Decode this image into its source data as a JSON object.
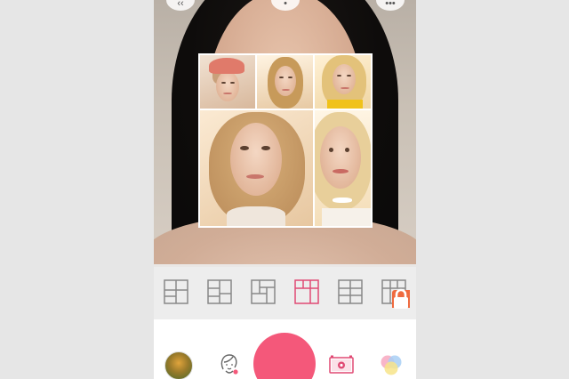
{
  "app": {
    "screen": "collage-camera"
  },
  "top_bar": {
    "buttons": [
      {
        "name": "back-icon"
      },
      {
        "name": "info-icon"
      },
      {
        "name": "more-icon"
      }
    ]
  },
  "collage": {
    "selected_layout_index": 3,
    "photos": [
      {
        "name": "collage-photo-1",
        "hair": "#d9b98a",
        "hat": "#e07a6a"
      },
      {
        "name": "collage-photo-2",
        "hair": "#c79a5a"
      },
      {
        "name": "collage-photo-3",
        "hair": "#e3c27a",
        "shirt": "#f0c21a"
      },
      {
        "name": "collage-photo-4",
        "hair": "#caa06a"
      },
      {
        "name": "collage-photo-5",
        "hair": "#e8cf9a"
      }
    ]
  },
  "layouts": [
    {
      "name": "layout-grid-1",
      "locked": false
    },
    {
      "name": "layout-grid-2",
      "locked": false
    },
    {
      "name": "layout-grid-3",
      "locked": false
    },
    {
      "name": "layout-grid-4",
      "locked": false,
      "selected": true
    },
    {
      "name": "layout-grid-5",
      "locked": false
    },
    {
      "name": "layout-grid-6",
      "locked": true
    }
  ],
  "toolbar": {
    "items": [
      "gallery-thumbnail",
      "beauty-face-icon",
      "shutter-button",
      "camera-mode-icon",
      "filter-icon"
    ]
  },
  "colors": {
    "accent": "#f4587a",
    "lock": "#ef6a3f",
    "layout_icon": "#888888",
    "layout_icon_selected": "#e04a74"
  }
}
